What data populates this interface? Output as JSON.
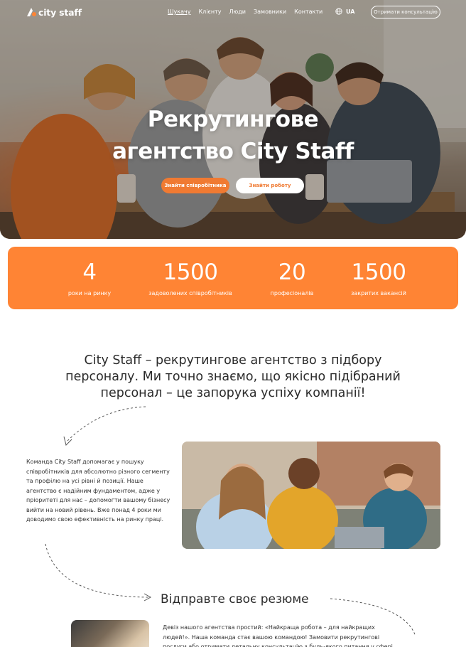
{
  "brand": {
    "name": "city staff",
    "accent": "#ff8434"
  },
  "nav": {
    "items": [
      {
        "label": "Шукачу",
        "active": true
      },
      {
        "label": "Клієнту",
        "active": false
      },
      {
        "label": "Люди",
        "active": false
      },
      {
        "label": "Замовники",
        "active": false
      },
      {
        "label": "Контакти",
        "active": false
      }
    ],
    "lang": "UA",
    "lang_icon": "globe-icon",
    "cta": "Отримати консультацію"
  },
  "hero": {
    "title_line1": "Рекрутингове",
    "title_line2": "агентство City Staff",
    "btn_find_employee": "Знайти співробітника",
    "btn_find_job": "Знайти роботу"
  },
  "stats": [
    {
      "value": "4",
      "label": "роки на ринку"
    },
    {
      "value": "1500",
      "label": "задоволених співробітників"
    },
    {
      "value": "20",
      "label": "професіоналів"
    },
    {
      "value": "1500",
      "label": "закритих вакансій"
    }
  ],
  "intro": {
    "line1": "City Staff – рекрутингове агентство з підбору",
    "line2": "персоналу. Ми точно знаємо, що якісно підібраний",
    "line3": "персонал – це запорука успіху компанії!"
  },
  "about": {
    "text": "Команда City Staff допомагає у пошуку співробітників для абсолютно різного сегменту та профілю на усі рівні й позиції. Наше агентство є надійним фундаментом, адже у пріоритеті для нас – допомогти вашому бізнесу вийти на новий рівень. Вже понад 4 роки ми доводимо свою ефективність на ринку праці."
  },
  "resume": {
    "title": "Відправте своє резюме",
    "text": "Девіз нашого агентства простий: «Найкраща робота – для найкращих людей!». Наша команда стає вашою командою! Замовити рекрутингові послуги або отримати детальну консультацію з будь-якого питання у сфері"
  }
}
